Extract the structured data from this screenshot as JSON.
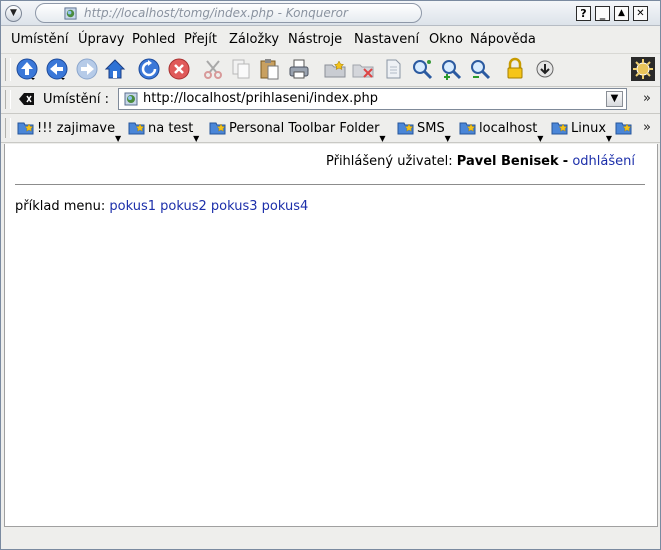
{
  "window": {
    "title": "http://localhost/tomg/index.php - Konqueror",
    "buttons": [
      "?",
      "_",
      "▲",
      "✕"
    ]
  },
  "menubar": {
    "items": [
      {
        "label": "Umístění"
      },
      {
        "label": "Úpravy"
      },
      {
        "label": "Pohled"
      },
      {
        "label": "Přejít"
      },
      {
        "label": "Záložky"
      },
      {
        "label": "Nástroje"
      },
      {
        "label": "Nastavení"
      },
      {
        "label": "Okno"
      },
      {
        "label": "Nápověda"
      }
    ]
  },
  "toolbar": {
    "icons": [
      "up-arrow-icon",
      "back-arrow-icon",
      "forward-arrow-icon",
      "home-icon",
      "reload-icon",
      "stop-icon",
      "cut-icon",
      "copy-icon",
      "paste-icon",
      "print-icon",
      "new-folder-icon",
      "delete-icon",
      "file-icon",
      "zoom-icon",
      "zoom-in-icon",
      "zoom-out-icon",
      "lock-icon",
      "download-icon",
      "konqueror-gear-icon"
    ]
  },
  "location": {
    "label": "Umístění :",
    "url": "http://localhost/prihlaseni/index.php"
  },
  "bookmarks": {
    "items": [
      {
        "label": "!!! zajimave"
      },
      {
        "label": "na test"
      },
      {
        "label": "Personal Toolbar Folder"
      },
      {
        "label": "SMS"
      },
      {
        "label": "localhost"
      },
      {
        "label": "Linux"
      }
    ]
  },
  "page": {
    "login_prefix": "Přihlášený uživatel:",
    "user_name": "Pavel Benisek",
    "separator": "-",
    "logout_link": "odhlášení",
    "menu_prefix": "příklad menu:",
    "menu_links": [
      "pokus1",
      "pokus2",
      "pokus3",
      "pokus4"
    ]
  },
  "colors": {
    "link": "#1c2faa",
    "chrome": "#eeeeec"
  }
}
